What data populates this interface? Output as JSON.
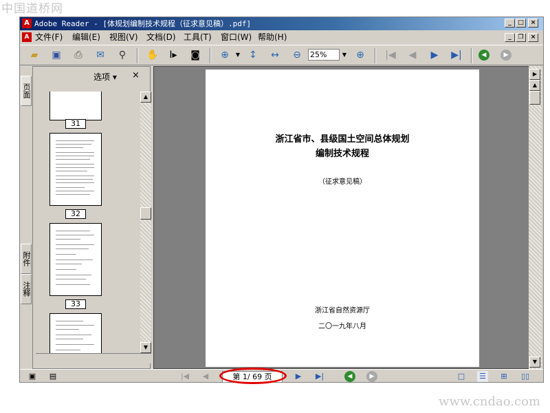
{
  "watermark_top": "中国道桥网",
  "watermark_bottom": "www.cndao.com",
  "window": {
    "title": "Adobe Reader - [体规划编制技术规程（征求意见稿）.pdf]"
  },
  "menu": [
    "文件(F)",
    "编辑(E)",
    "视图(V)",
    "文档(D)",
    "工具(T)",
    "窗口(W)",
    "帮助(H)"
  ],
  "toolbar": {
    "zoom_value": "25%"
  },
  "nav_panel": {
    "tabs": [
      "页面",
      "附件",
      "注释"
    ],
    "options_label": "选项 ▾",
    "close_label": "×",
    "thumbnails": [
      "31",
      "32",
      "33"
    ]
  },
  "document": {
    "title_line1": "浙江省市、县级国土空间总体规划",
    "title_line2": "编制技术规程",
    "subtitle": "（征求意见稿）",
    "issuer": "浙江省自然资源厅",
    "date": "二〇一九年八月"
  },
  "status": {
    "page_display": "第 1/ 69 页"
  },
  "colors": {
    "accent_red": "#e00000",
    "title_bar": "#0a246a",
    "nav_green": "#2e8b2e"
  }
}
